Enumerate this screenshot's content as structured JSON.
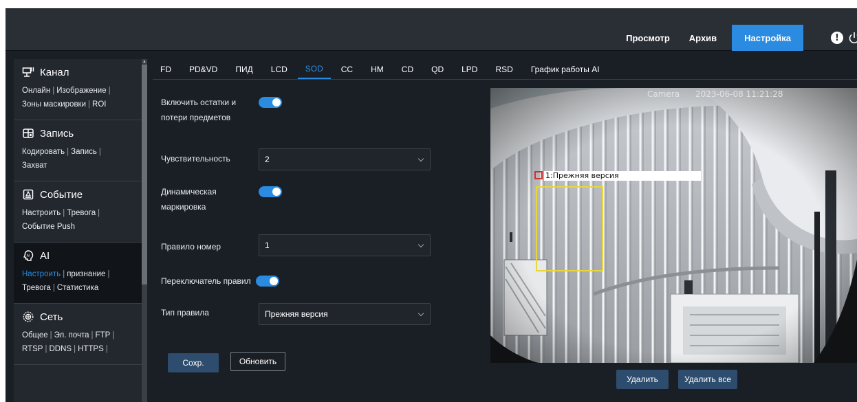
{
  "header": {
    "nav": [
      {
        "label": "Просмотр"
      },
      {
        "label": "Архив"
      },
      {
        "label": "Настройка"
      }
    ],
    "alert_glyph": "!",
    "accent_color": "#2a8be0"
  },
  "sidebar": {
    "sections": [
      {
        "title": "Канал",
        "icon": "channel-icon",
        "links": [
          "Онлайн",
          "Изображение",
          "Зоны маскировки",
          "ROI"
        ]
      },
      {
        "title": "Запись",
        "icon": "record-icon",
        "links": [
          "Кодировать",
          "Запись",
          "Захват"
        ]
      },
      {
        "title": "Событие",
        "icon": "event-icon",
        "links": [
          "Настроить",
          "Тревога",
          "Событие Push"
        ]
      },
      {
        "title": "AI",
        "icon": "ai-icon",
        "links": [
          "Настроить",
          "признание",
          "Тревога",
          "Статистика"
        ]
      },
      {
        "title": "Сеть",
        "icon": "network-icon",
        "links": [
          "Общее",
          "Эл. почта",
          "FTP",
          "RTSP",
          "DDNS",
          "HTTPS"
        ]
      }
    ]
  },
  "tabs": [
    "FD",
    "PD&VD",
    "ПИД",
    "LCD",
    "SOD",
    "CC",
    "HM",
    "CD",
    "QD",
    "LPD",
    "RSD",
    "График работы AI"
  ],
  "form": {
    "enable_label_1": "Включить остатки и",
    "enable_label_2": "потери предметов",
    "sensitivity_label": "Чувствительность",
    "sensitivity_value": "2",
    "dynamic_label_1": "Динамическая",
    "dynamic_label_2": "маркировка",
    "rule_number_label": "Правило номер",
    "rule_number_value": "1",
    "rule_switch_label": "Переключатель правил",
    "rule_type_label": "Тип правила",
    "rule_type_value": "Прежняя версия",
    "save_label": "Сохр.",
    "refresh_label": "Обновить"
  },
  "video": {
    "camera_name": "Camera",
    "timestamp": "2023-06-08 11:21:28",
    "detection_label": "1:Прежняя версия",
    "delete_label": "Удалить",
    "delete_all_label": "Удалить все"
  }
}
